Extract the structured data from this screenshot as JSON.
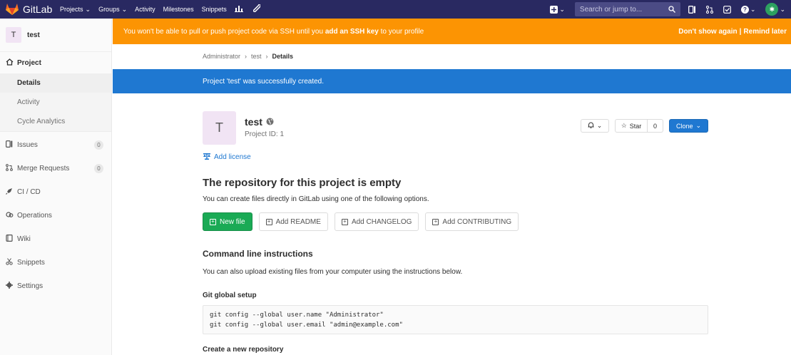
{
  "navbar": {
    "brand": "GitLab",
    "items": [
      {
        "label": "Projects",
        "dropdown": true
      },
      {
        "label": "Groups",
        "dropdown": true
      },
      {
        "label": "Activity",
        "dropdown": false
      },
      {
        "label": "Milestones",
        "dropdown": false
      },
      {
        "label": "Snippets",
        "dropdown": false
      }
    ],
    "search_placeholder": "Search or jump to...",
    "icons": [
      "chart-icon",
      "wrench-icon",
      "plus-icon",
      "issues-icon",
      "merge-request-icon",
      "todo-icon",
      "help-icon",
      "avatar"
    ]
  },
  "sidebar": {
    "project_initial": "T",
    "project_name": "test",
    "project_section": {
      "label": "Project",
      "items": [
        "Details",
        "Activity",
        "Cycle Analytics"
      ],
      "active": "Details"
    },
    "items": [
      {
        "label": "Issues",
        "count": "0",
        "icon": "issues-icon"
      },
      {
        "label": "Merge Requests",
        "count": "0",
        "icon": "merge-request-icon"
      },
      {
        "label": "CI / CD",
        "icon": "rocket-icon"
      },
      {
        "label": "Operations",
        "icon": "cloud-icon"
      },
      {
        "label": "Wiki",
        "icon": "book-icon"
      },
      {
        "label": "Snippets",
        "icon": "scissors-icon"
      },
      {
        "label": "Settings",
        "icon": "gear-icon"
      }
    ]
  },
  "ssh_alert": {
    "text_before": "You won't be able to pull or push project code via SSH until you ",
    "link": "add an SSH key",
    "text_after": " to your profile",
    "dont_show": "Don't show again",
    "separator": "|",
    "remind": "Remind later"
  },
  "breadcrumb": {
    "items": [
      "Administrator",
      "test",
      "Details"
    ],
    "separator": "›"
  },
  "flash": "Project 'test' was successfully created.",
  "project": {
    "initial": "T",
    "name": "test",
    "id_text": "Project ID: 1",
    "add_license": "Add license",
    "star_label": "Star",
    "star_count": "0",
    "clone_label": "Clone"
  },
  "empty": {
    "title": "The repository for this project is empty",
    "desc": "You can create files directly in GitLab using one of the following options.",
    "buttons": [
      "New file",
      "Add README",
      "Add CHANGELOG",
      "Add CONTRIBUTING"
    ]
  },
  "cli": {
    "title": "Command line instructions",
    "desc": "You can also upload existing files from your computer using the instructions below.",
    "git_global_title": "Git global setup",
    "code_lines": [
      "git config --global user.name \"Administrator\"",
      "git config --global user.email \"admin@example.com\""
    ],
    "create_repo_title": "Create a new repository"
  },
  "colors": {
    "navbar": "#292961",
    "alert": "#fc9403",
    "flash": "#1f78d1",
    "primary_button": "#1aaa55",
    "clone_button": "#1f78d1"
  }
}
